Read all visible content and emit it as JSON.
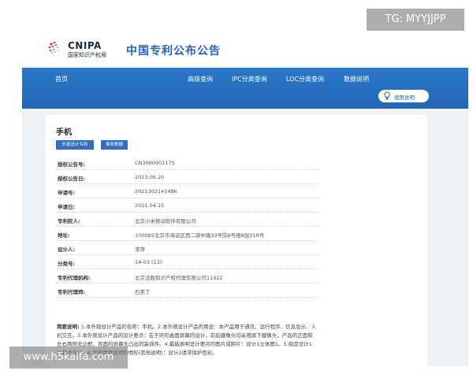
{
  "watermarks": {
    "top_right": "TG: MYYJJPP",
    "bottom_left": "www.h5kaifa.com"
  },
  "header": {
    "logo_en": "CNIPA",
    "logo_cn": "国家知识产权局",
    "site_title": "中国专利公布公告",
    "logo_colors": {
      "dots": "#d22f2f",
      "text": "#1a2a4a"
    }
  },
  "nav": {
    "items": [
      "首页",
      "高级查询",
      "IPC分类查询",
      "LOC分类查询",
      "数据说明"
    ],
    "guide_label": "使用说明",
    "guide_icon": "lightbulb-icon",
    "bar_color": "#2a77c9"
  },
  "record": {
    "title": "手机",
    "tags": [
      "外观设计专利",
      "事务数据"
    ],
    "fields": [
      {
        "label": "授权公告号:",
        "value": "CN308090117S"
      },
      {
        "label": "授权公告日:",
        "value": "2023.06.20"
      },
      {
        "label": "申请号:",
        "value": "2021302141486"
      },
      {
        "label": "申请日:",
        "value": "2021.04.15"
      },
      {
        "label": "专利权人:",
        "value": "北京小米移动软件有限公司"
      },
      {
        "label": "地址:",
        "value": "100085北京市海淀区西二旗中路33号院6号楼8层018号"
      },
      {
        "label": "设计人:",
        "value": "李萍"
      },
      {
        "label": "分类号:",
        "value": "14-03 (13)"
      },
      {
        "label": "专利代理机构:",
        "value": "北京法胜知识产权代理有限公司11922"
      },
      {
        "label": "专利代理师:",
        "value": "石美丁"
      }
    ],
    "brief_label": "简要说明:",
    "brief_text": "1.本外观设计产品的名称：手机。2.本外观设计产品的用途：本产品用于通讯、运行程序、信息显示、人机交互。3.本外观设计产品的设计要点：在于环形曲面屏幕的设计，前后摄像头均采用屏下摄像头，产品的正面和左右两侧无边框，背面的屏幕无凸出的装饰件。4.最能表明设计要点的图片或照片：设计1立体图1。5.指定设计1为基本设计。6.其他需要说明的情形(其他说明)：设计2请求保护色彩。"
  }
}
